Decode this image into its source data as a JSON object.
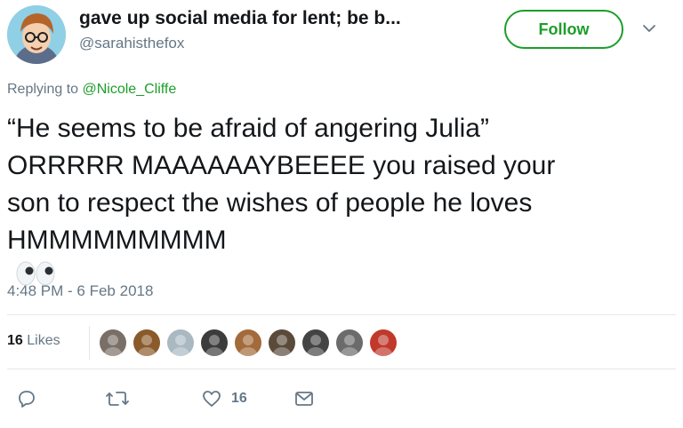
{
  "tweet": {
    "display_name": "gave up social media for lent; be b...",
    "handle": "@sarahisthefox",
    "follow_label": "Follow",
    "replying_prefix": "Replying to",
    "replying_to": "@Nicole_Cliffe",
    "text_lines": [
      "“He seems to be afraid of angering Julia”",
      "ORRRRR MAAAAAAYBEEEE you raised your",
      "son to respect the wishes of people he loves",
      "HMMMMMMMMM"
    ],
    "emoji": "eyes-emoji",
    "timestamp": "4:48 PM - 6 Feb 2018",
    "likes_number": "16",
    "likes_word": "Likes",
    "like_action_count": "16"
  },
  "likers": [
    {
      "icon": "liker-avatar-1",
      "color": "#7a6f66"
    },
    {
      "icon": "liker-avatar-2",
      "color": "#8a5a2b"
    },
    {
      "icon": "liker-avatar-3",
      "color": "#aab8c2"
    },
    {
      "icon": "liker-avatar-4",
      "color": "#3c3c3c"
    },
    {
      "icon": "liker-avatar-5",
      "color": "#a36a3a"
    },
    {
      "icon": "liker-avatar-6",
      "color": "#5a4a3a"
    },
    {
      "icon": "liker-avatar-7",
      "color": "#444444"
    },
    {
      "icon": "liker-avatar-8",
      "color": "#6b6b6b"
    },
    {
      "icon": "liker-avatar-9",
      "color": "#c0392b"
    }
  ],
  "colors": {
    "accent": "#1c9e29",
    "text": "#14171a",
    "secondary": "#657786",
    "divider": "#e1e8ed"
  }
}
